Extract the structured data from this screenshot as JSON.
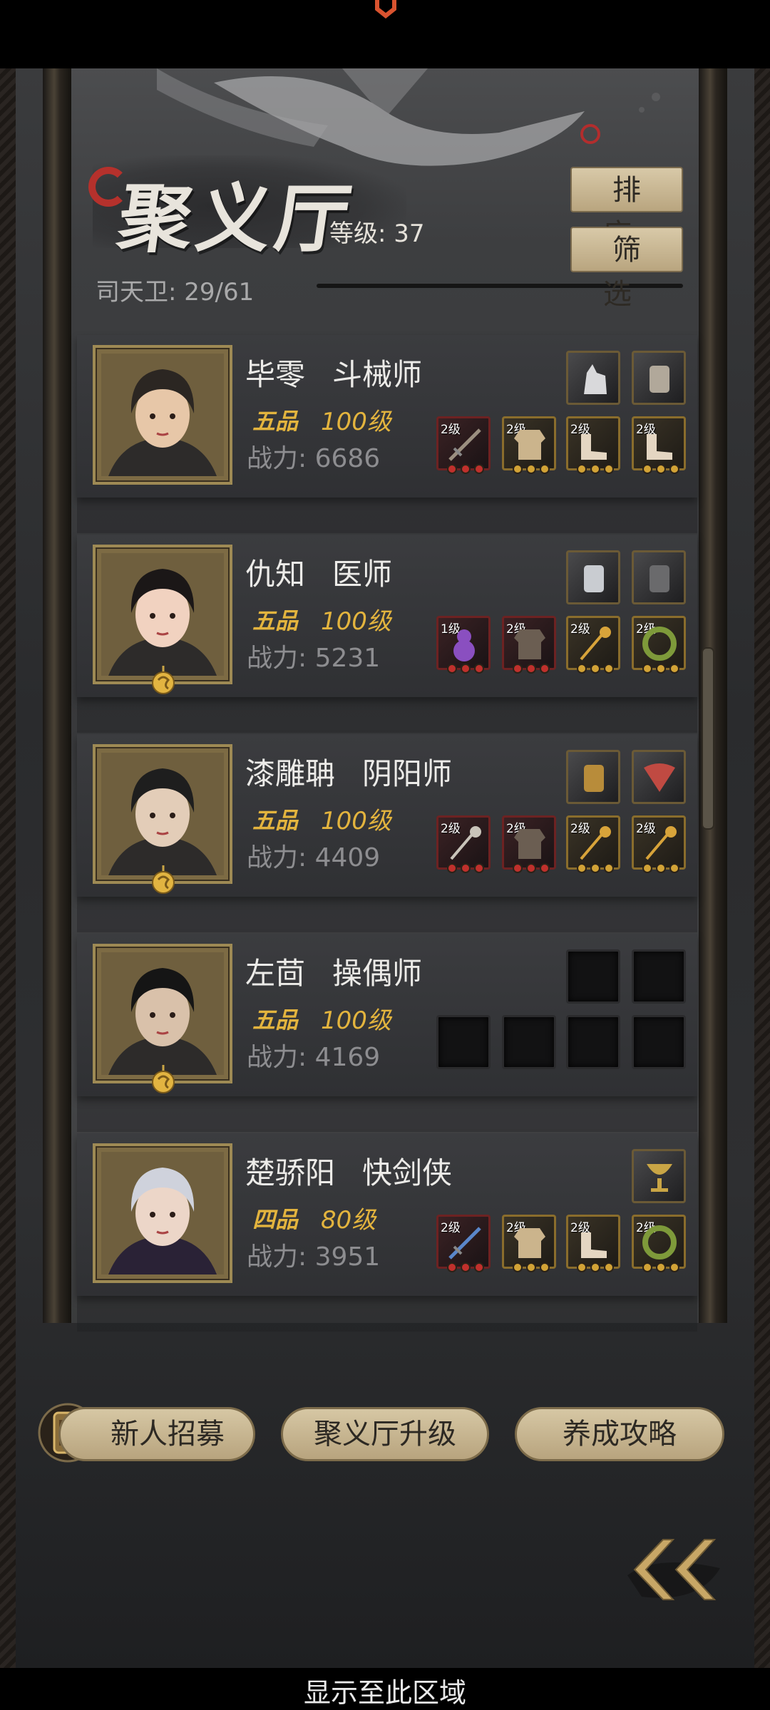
{
  "header": {
    "title": "聚义厅",
    "level_label": "等级: 37",
    "guard_count": "司天卫: 29/61",
    "sort_button": "排序",
    "filter_button": "筛选"
  },
  "heroes": [
    {
      "name": "毕零",
      "role": "斗械师",
      "grade": "五品",
      "level": "100级",
      "power": "战力: 6686",
      "has_badge": false,
      "skills": [
        "wolf-icon",
        "comb-icon"
      ],
      "equipment": [
        {
          "level": "2级",
          "rarity": "red",
          "icon": "crossbow-icon"
        },
        {
          "level": "2级",
          "rarity": "gold",
          "icon": "armor-icon"
        },
        {
          "level": "2级",
          "rarity": "gold",
          "icon": "boots-icon"
        },
        {
          "level": "2级",
          "rarity": "gold",
          "icon": "boots-icon"
        }
      ]
    },
    {
      "name": "仇知",
      "role": "医师",
      "grade": "五品",
      "level": "100级",
      "power": "战力: 5231",
      "has_badge": true,
      "skills": [
        "flask-icon",
        "shield-icon"
      ],
      "equipment": [
        {
          "level": "1级",
          "rarity": "red",
          "icon": "gourd-icon"
        },
        {
          "level": "2级",
          "rarity": "red",
          "icon": "robe-icon"
        },
        {
          "level": "2级",
          "rarity": "gold",
          "icon": "staff-icon"
        },
        {
          "level": "2级",
          "rarity": "gold",
          "icon": "ring-icon"
        }
      ]
    },
    {
      "name": "漆雕聃",
      "role": "阴阳师",
      "grade": "五品",
      "level": "100级",
      "power": "战力: 4409",
      "has_badge": true,
      "skills": [
        "leaf-icon",
        "fan-icon"
      ],
      "equipment": [
        {
          "level": "2级",
          "rarity": "red",
          "icon": "mace-icon"
        },
        {
          "level": "2级",
          "rarity": "red",
          "icon": "robe-icon"
        },
        {
          "level": "2级",
          "rarity": "gold",
          "icon": "staff-icon"
        },
        {
          "level": "2级",
          "rarity": "gold",
          "icon": "staff-icon"
        }
      ]
    },
    {
      "name": "左茴",
      "role": "操偶师",
      "grade": "五品",
      "level": "100级",
      "power": "战力: 4169",
      "has_badge": true,
      "skills": [
        "empty",
        "empty"
      ],
      "equipment": [
        {
          "level": "",
          "rarity": "empty",
          "icon": ""
        },
        {
          "level": "",
          "rarity": "empty",
          "icon": ""
        },
        {
          "level": "",
          "rarity": "empty",
          "icon": ""
        },
        {
          "level": "",
          "rarity": "empty",
          "icon": ""
        }
      ]
    },
    {
      "name": "楚骄阳",
      "role": "快剑侠",
      "grade": "四品",
      "level": "80级",
      "power": "战力: 3951",
      "has_badge": false,
      "skills": [
        "chalice-icon"
      ],
      "equipment": [
        {
          "level": "2级",
          "rarity": "red",
          "icon": "sword-icon"
        },
        {
          "level": "2级",
          "rarity": "gold",
          "icon": "armor-icon"
        },
        {
          "level": "2级",
          "rarity": "gold",
          "icon": "boots-icon"
        },
        {
          "level": "2级",
          "rarity": "gold",
          "icon": "ring-icon"
        }
      ]
    }
  ],
  "footer": {
    "recruit_button": "新人招募",
    "upgrade_button": "聚义厅升级",
    "guide_button": "养成攻略"
  },
  "bottom_hint": "显示至此区域",
  "colors": {
    "gold": "#e3b43e",
    "button_bg": "#cbb994",
    "red_rarity": "#c0302c"
  }
}
